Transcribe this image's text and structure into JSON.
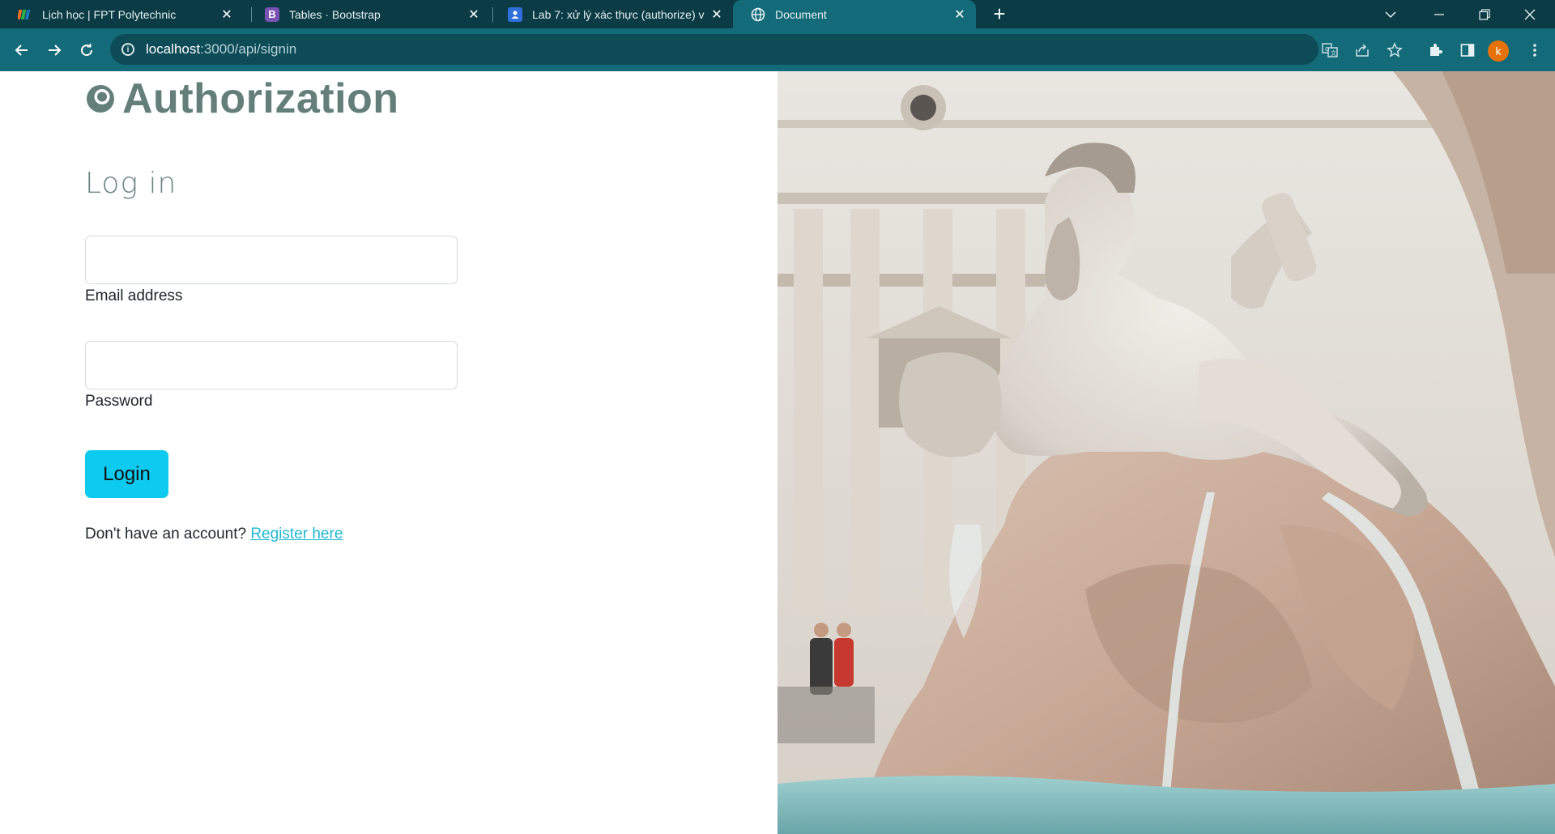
{
  "browser": {
    "tabs": [
      {
        "title": "Lịch học | FPT Polytechnic",
        "favicon": "fpt-icon",
        "active": false
      },
      {
        "title": "Tables · Bootstrap",
        "favicon": "bootstrap-icon",
        "active": false
      },
      {
        "title": "Lab 7: xử lý xác thực (authorize) v",
        "favicon": "classroom-icon",
        "active": false
      },
      {
        "title": "Document",
        "favicon": "globe-icon",
        "active": true
      }
    ],
    "address": {
      "host": "localhost",
      "path": ":3000/api/signin"
    },
    "profile_initial": "k",
    "colors": {
      "tabstrip": "#0b3b45",
      "toolbar": "#136b7a",
      "profile": "#e8710a"
    }
  },
  "page": {
    "brand": "Authorization",
    "heading": "Log in",
    "email_label": "Email address",
    "password_label": "Password",
    "email_value": "",
    "password_value": "",
    "login_label": "Login",
    "register_prompt": "Don't have an account?",
    "register_link": "Register here",
    "colors": {
      "brand": "#637f78",
      "button": "#0dcaf0",
      "link": "#1fb8d3"
    }
  }
}
